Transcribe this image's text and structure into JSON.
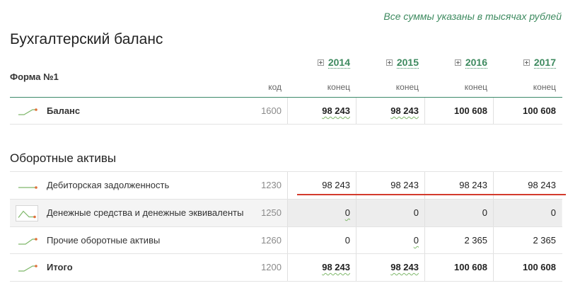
{
  "page": {
    "note": "Все суммы указаны в тысячах рублей",
    "title": "Бухгалтерский баланс",
    "form_label": "Форма №1"
  },
  "columns": {
    "code_header": "код",
    "years": [
      {
        "label": "2014",
        "sub": "конец"
      },
      {
        "label": "2015",
        "sub": "конец"
      },
      {
        "label": "2016",
        "sub": "конец"
      },
      {
        "label": "2017",
        "sub": "конец"
      }
    ]
  },
  "balance_row": {
    "label": "Баланс",
    "code": "1600",
    "values": [
      "98 243",
      "98 243",
      "100 608",
      "100 608"
    ]
  },
  "section": {
    "title": "Оборотные активы",
    "rows": [
      {
        "label": "Дебиторская задолженность",
        "code": "1230",
        "values": [
          "98 243",
          "98 243",
          "98 243",
          "98 243"
        ]
      },
      {
        "label": "Денежные средства и денежные эквиваленты",
        "code": "1250",
        "values": [
          "0",
          "0",
          "0",
          "0"
        ]
      },
      {
        "label": "Прочие оборотные активы",
        "code": "1260",
        "values": [
          "0",
          "0",
          "2 365",
          "2 365"
        ]
      },
      {
        "label": "Итого",
        "code": "1200",
        "values": [
          "98 243",
          "98 243",
          "100 608",
          "100 608"
        ]
      }
    ]
  },
  "colors": {
    "accent": "#3d8a5f",
    "sparkline": "#7fb86a",
    "sparkline_dot": "#e0703a",
    "highlight_line": "#d33b2c"
  }
}
